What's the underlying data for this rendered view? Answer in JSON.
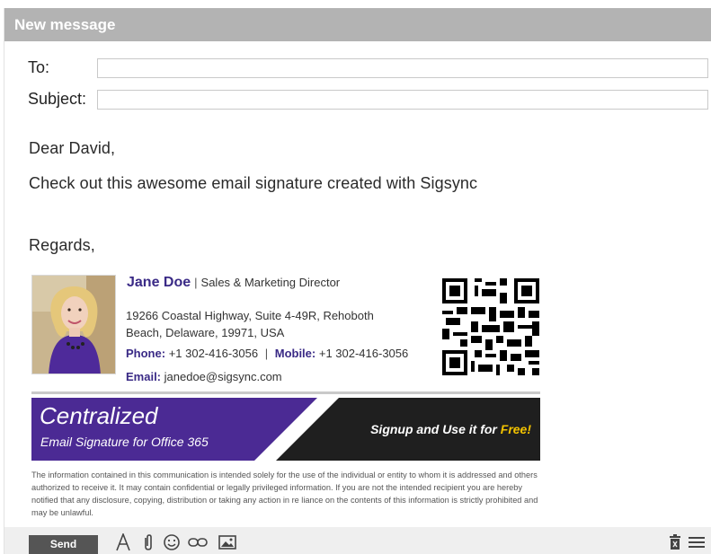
{
  "window": {
    "title": "New message"
  },
  "compose": {
    "to_label": "To:",
    "to_value": "",
    "subject_label": "Subject:",
    "subject_value": ""
  },
  "message": {
    "greeting": "Dear David,",
    "line1": "Check out this awesome email signature created with Sigsync",
    "closing": "Regards,"
  },
  "signature": {
    "name": "Jane Doe",
    "separator": "|",
    "title": "Sales & Marketing Director",
    "address_line1": "19266 Coastal Highway, Suite 4-49R, Rehoboth",
    "address_line2": "Beach, Delaware, 19971, USA",
    "phone_label": "Phone:",
    "phone": "+1 302-416-3056",
    "mobile_label": "Mobile:",
    "mobile": "+1 302-416-3056",
    "email_label": "Email:",
    "email": "janedoe@sigsync.com",
    "banner_title": "Centralized",
    "banner_subtitle": "Email Signature for Office 365",
    "banner_cta": "Signup and Use it for",
    "banner_cta_highlight": "Free!",
    "disclaimer": "The information contained in this communication is intended solely for the use of the individual or entity to whom it is addressed and others authorized to receive it. It may contain confidential or legally privileged information. If you are not the intended recipient you are hereby notified that any disclosure, copying, distribution or taking any action in re liance on the contents of this information is strictly prohibited and may be unlawful."
  },
  "toolbar": {
    "send_label": "Send",
    "icons": [
      "format-text-icon",
      "attach-icon",
      "emoji-icon",
      "link-icon",
      "image-icon",
      "discard-icon",
      "more-menu-icon"
    ]
  },
  "colors": {
    "titlebar": "#b3b3b3",
    "brand_purple": "#3a2a86",
    "banner_purple": "#4b2a94",
    "banner_dark": "#1f1f1f",
    "highlight": "#f2c200",
    "send_button": "#555555"
  }
}
